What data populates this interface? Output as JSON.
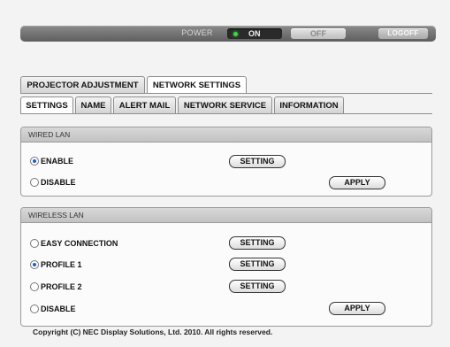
{
  "power_bar": {
    "power_label": "POWER",
    "on_label": "ON",
    "off_label": "OFF",
    "logoff_label": "LOGOFF",
    "status_color": "#42d242"
  },
  "main_tabs": [
    {
      "label": "PROJECTOR ADJUSTMENT",
      "active": false
    },
    {
      "label": "NETWORK SETTINGS",
      "active": true
    }
  ],
  "sub_tabs": [
    {
      "label": "SETTINGS",
      "active": true
    },
    {
      "label": "NAME",
      "active": false
    },
    {
      "label": "ALERT MAIL",
      "active": false
    },
    {
      "label": "NETWORK SERVICE",
      "active": false
    },
    {
      "label": "INFORMATION",
      "active": false
    }
  ],
  "wired_lan": {
    "title": "WIRED LAN",
    "options": [
      {
        "label": "ENABLE",
        "checked": true,
        "button": "SETTING"
      },
      {
        "label": "DISABLE",
        "checked": false,
        "button": ""
      }
    ],
    "apply_label": "APPLY"
  },
  "wireless_lan": {
    "title": "WIRELESS LAN",
    "options": [
      {
        "label": "EASY CONNECTION",
        "checked": false,
        "button": "SETTING"
      },
      {
        "label": "PROFILE 1",
        "checked": true,
        "button": "SETTING"
      },
      {
        "label": "PROFILE 2",
        "checked": false,
        "button": "SETTING"
      },
      {
        "label": "DISABLE",
        "checked": false,
        "button": ""
      }
    ],
    "apply_label": "APPLY"
  },
  "footer": {
    "copyright": "Copyright (C) NEC Display Solutions, Ltd. 2010. All rights reserved."
  }
}
